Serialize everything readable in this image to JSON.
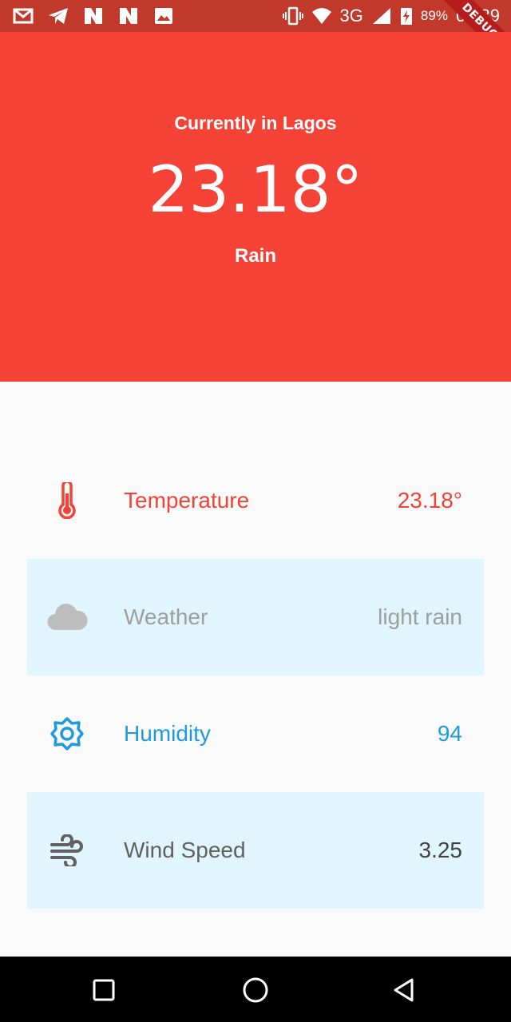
{
  "status_bar": {
    "battery_percent": "89%",
    "network": "3G",
    "time": "01:39",
    "debug_label": "DEBUG"
  },
  "header": {
    "subtitle": "Currently in Lagos",
    "temperature": "23.18°",
    "condition": "Rain",
    "background": "#f44336"
  },
  "rows": [
    {
      "label": "Temperature",
      "value": "23.18°",
      "icon": "thermometer-icon",
      "color": "#f44336"
    },
    {
      "label": "Weather",
      "value": "light rain",
      "icon": "cloud-icon",
      "color": "#9e9e9e"
    },
    {
      "label": "Humidity",
      "value": "94",
      "icon": "gear-icon",
      "color": "#1e9be0"
    },
    {
      "label": "Wind Speed",
      "value": "3.25",
      "icon": "wind-icon",
      "color": "#616161"
    }
  ],
  "nav": {
    "items": [
      "recents-button",
      "home-button",
      "back-button"
    ]
  }
}
